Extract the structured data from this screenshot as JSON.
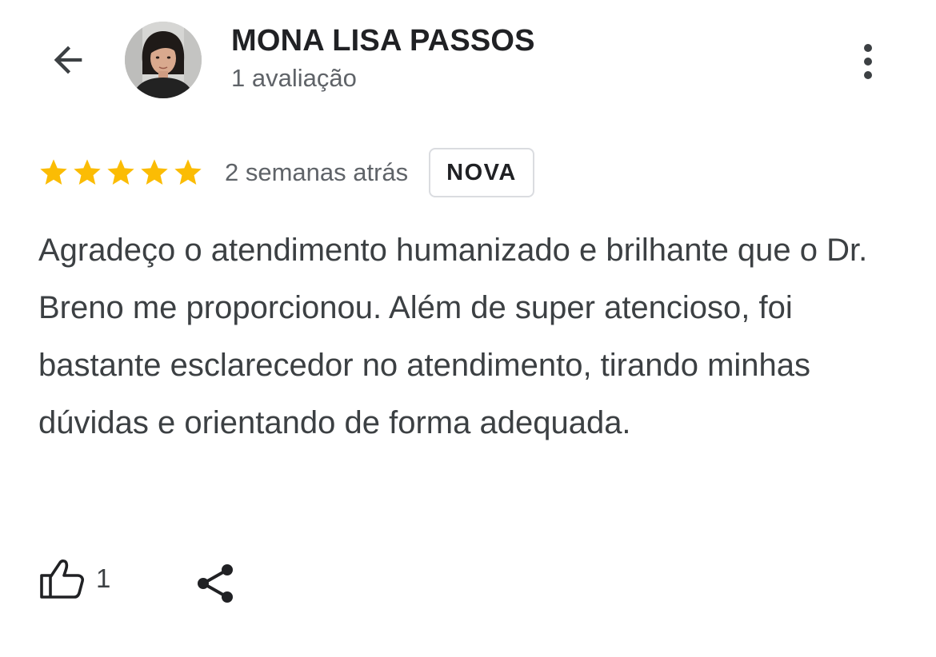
{
  "header": {
    "back_icon": "arrow-back-icon",
    "reviewer_name": "MONA LISA PASSOS",
    "review_count": "1 avaliação",
    "more_icon": "more-vert-icon"
  },
  "review": {
    "rating": 5,
    "max_rating": 5,
    "star_color": "#FBBC04",
    "time": "2 semanas atrás",
    "badge": "NOVA",
    "text": "Agradeço o atendimento humanizado e brilhante que o Dr. Breno me proporcionou. Além de super atencioso, foi bastante esclarecedor no atendimento, tirando minhas dúvidas e orientando de forma adequada."
  },
  "actions": {
    "like_icon": "thumb-up-icon",
    "like_count": "1",
    "share_icon": "share-icon"
  }
}
